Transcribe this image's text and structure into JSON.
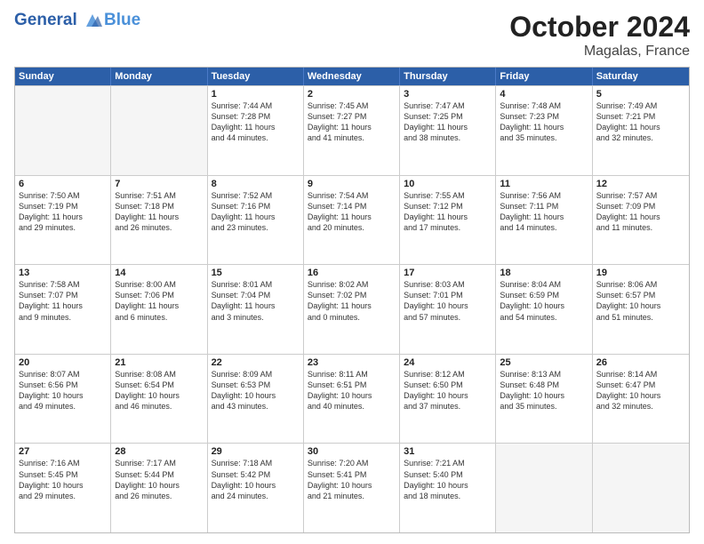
{
  "header": {
    "logo_line1": "General",
    "logo_line2": "Blue",
    "month": "October 2024",
    "location": "Magalas, France"
  },
  "weekdays": [
    "Sunday",
    "Monday",
    "Tuesday",
    "Wednesday",
    "Thursday",
    "Friday",
    "Saturday"
  ],
  "rows": [
    [
      {
        "day": "",
        "lines": [],
        "empty": true
      },
      {
        "day": "",
        "lines": [],
        "empty": true
      },
      {
        "day": "1",
        "lines": [
          "Sunrise: 7:44 AM",
          "Sunset: 7:28 PM",
          "Daylight: 11 hours",
          "and 44 minutes."
        ]
      },
      {
        "day": "2",
        "lines": [
          "Sunrise: 7:45 AM",
          "Sunset: 7:27 PM",
          "Daylight: 11 hours",
          "and 41 minutes."
        ]
      },
      {
        "day": "3",
        "lines": [
          "Sunrise: 7:47 AM",
          "Sunset: 7:25 PM",
          "Daylight: 11 hours",
          "and 38 minutes."
        ]
      },
      {
        "day": "4",
        "lines": [
          "Sunrise: 7:48 AM",
          "Sunset: 7:23 PM",
          "Daylight: 11 hours",
          "and 35 minutes."
        ]
      },
      {
        "day": "5",
        "lines": [
          "Sunrise: 7:49 AM",
          "Sunset: 7:21 PM",
          "Daylight: 11 hours",
          "and 32 minutes."
        ]
      }
    ],
    [
      {
        "day": "6",
        "lines": [
          "Sunrise: 7:50 AM",
          "Sunset: 7:19 PM",
          "Daylight: 11 hours",
          "and 29 minutes."
        ]
      },
      {
        "day": "7",
        "lines": [
          "Sunrise: 7:51 AM",
          "Sunset: 7:18 PM",
          "Daylight: 11 hours",
          "and 26 minutes."
        ]
      },
      {
        "day": "8",
        "lines": [
          "Sunrise: 7:52 AM",
          "Sunset: 7:16 PM",
          "Daylight: 11 hours",
          "and 23 minutes."
        ]
      },
      {
        "day": "9",
        "lines": [
          "Sunrise: 7:54 AM",
          "Sunset: 7:14 PM",
          "Daylight: 11 hours",
          "and 20 minutes."
        ]
      },
      {
        "day": "10",
        "lines": [
          "Sunrise: 7:55 AM",
          "Sunset: 7:12 PM",
          "Daylight: 11 hours",
          "and 17 minutes."
        ]
      },
      {
        "day": "11",
        "lines": [
          "Sunrise: 7:56 AM",
          "Sunset: 7:11 PM",
          "Daylight: 11 hours",
          "and 14 minutes."
        ]
      },
      {
        "day": "12",
        "lines": [
          "Sunrise: 7:57 AM",
          "Sunset: 7:09 PM",
          "Daylight: 11 hours",
          "and 11 minutes."
        ]
      }
    ],
    [
      {
        "day": "13",
        "lines": [
          "Sunrise: 7:58 AM",
          "Sunset: 7:07 PM",
          "Daylight: 11 hours",
          "and 9 minutes."
        ]
      },
      {
        "day": "14",
        "lines": [
          "Sunrise: 8:00 AM",
          "Sunset: 7:06 PM",
          "Daylight: 11 hours",
          "and 6 minutes."
        ]
      },
      {
        "day": "15",
        "lines": [
          "Sunrise: 8:01 AM",
          "Sunset: 7:04 PM",
          "Daylight: 11 hours",
          "and 3 minutes."
        ]
      },
      {
        "day": "16",
        "lines": [
          "Sunrise: 8:02 AM",
          "Sunset: 7:02 PM",
          "Daylight: 11 hours",
          "and 0 minutes."
        ]
      },
      {
        "day": "17",
        "lines": [
          "Sunrise: 8:03 AM",
          "Sunset: 7:01 PM",
          "Daylight: 10 hours",
          "and 57 minutes."
        ]
      },
      {
        "day": "18",
        "lines": [
          "Sunrise: 8:04 AM",
          "Sunset: 6:59 PM",
          "Daylight: 10 hours",
          "and 54 minutes."
        ]
      },
      {
        "day": "19",
        "lines": [
          "Sunrise: 8:06 AM",
          "Sunset: 6:57 PM",
          "Daylight: 10 hours",
          "and 51 minutes."
        ]
      }
    ],
    [
      {
        "day": "20",
        "lines": [
          "Sunrise: 8:07 AM",
          "Sunset: 6:56 PM",
          "Daylight: 10 hours",
          "and 49 minutes."
        ]
      },
      {
        "day": "21",
        "lines": [
          "Sunrise: 8:08 AM",
          "Sunset: 6:54 PM",
          "Daylight: 10 hours",
          "and 46 minutes."
        ]
      },
      {
        "day": "22",
        "lines": [
          "Sunrise: 8:09 AM",
          "Sunset: 6:53 PM",
          "Daylight: 10 hours",
          "and 43 minutes."
        ]
      },
      {
        "day": "23",
        "lines": [
          "Sunrise: 8:11 AM",
          "Sunset: 6:51 PM",
          "Daylight: 10 hours",
          "and 40 minutes."
        ]
      },
      {
        "day": "24",
        "lines": [
          "Sunrise: 8:12 AM",
          "Sunset: 6:50 PM",
          "Daylight: 10 hours",
          "and 37 minutes."
        ]
      },
      {
        "day": "25",
        "lines": [
          "Sunrise: 8:13 AM",
          "Sunset: 6:48 PM",
          "Daylight: 10 hours",
          "and 35 minutes."
        ]
      },
      {
        "day": "26",
        "lines": [
          "Sunrise: 8:14 AM",
          "Sunset: 6:47 PM",
          "Daylight: 10 hours",
          "and 32 minutes."
        ]
      }
    ],
    [
      {
        "day": "27",
        "lines": [
          "Sunrise: 7:16 AM",
          "Sunset: 5:45 PM",
          "Daylight: 10 hours",
          "and 29 minutes."
        ]
      },
      {
        "day": "28",
        "lines": [
          "Sunrise: 7:17 AM",
          "Sunset: 5:44 PM",
          "Daylight: 10 hours",
          "and 26 minutes."
        ]
      },
      {
        "day": "29",
        "lines": [
          "Sunrise: 7:18 AM",
          "Sunset: 5:42 PM",
          "Daylight: 10 hours",
          "and 24 minutes."
        ]
      },
      {
        "day": "30",
        "lines": [
          "Sunrise: 7:20 AM",
          "Sunset: 5:41 PM",
          "Daylight: 10 hours",
          "and 21 minutes."
        ]
      },
      {
        "day": "31",
        "lines": [
          "Sunrise: 7:21 AM",
          "Sunset: 5:40 PM",
          "Daylight: 10 hours",
          "and 18 minutes."
        ]
      },
      {
        "day": "",
        "lines": [],
        "empty": true
      },
      {
        "day": "",
        "lines": [],
        "empty": true
      }
    ]
  ]
}
